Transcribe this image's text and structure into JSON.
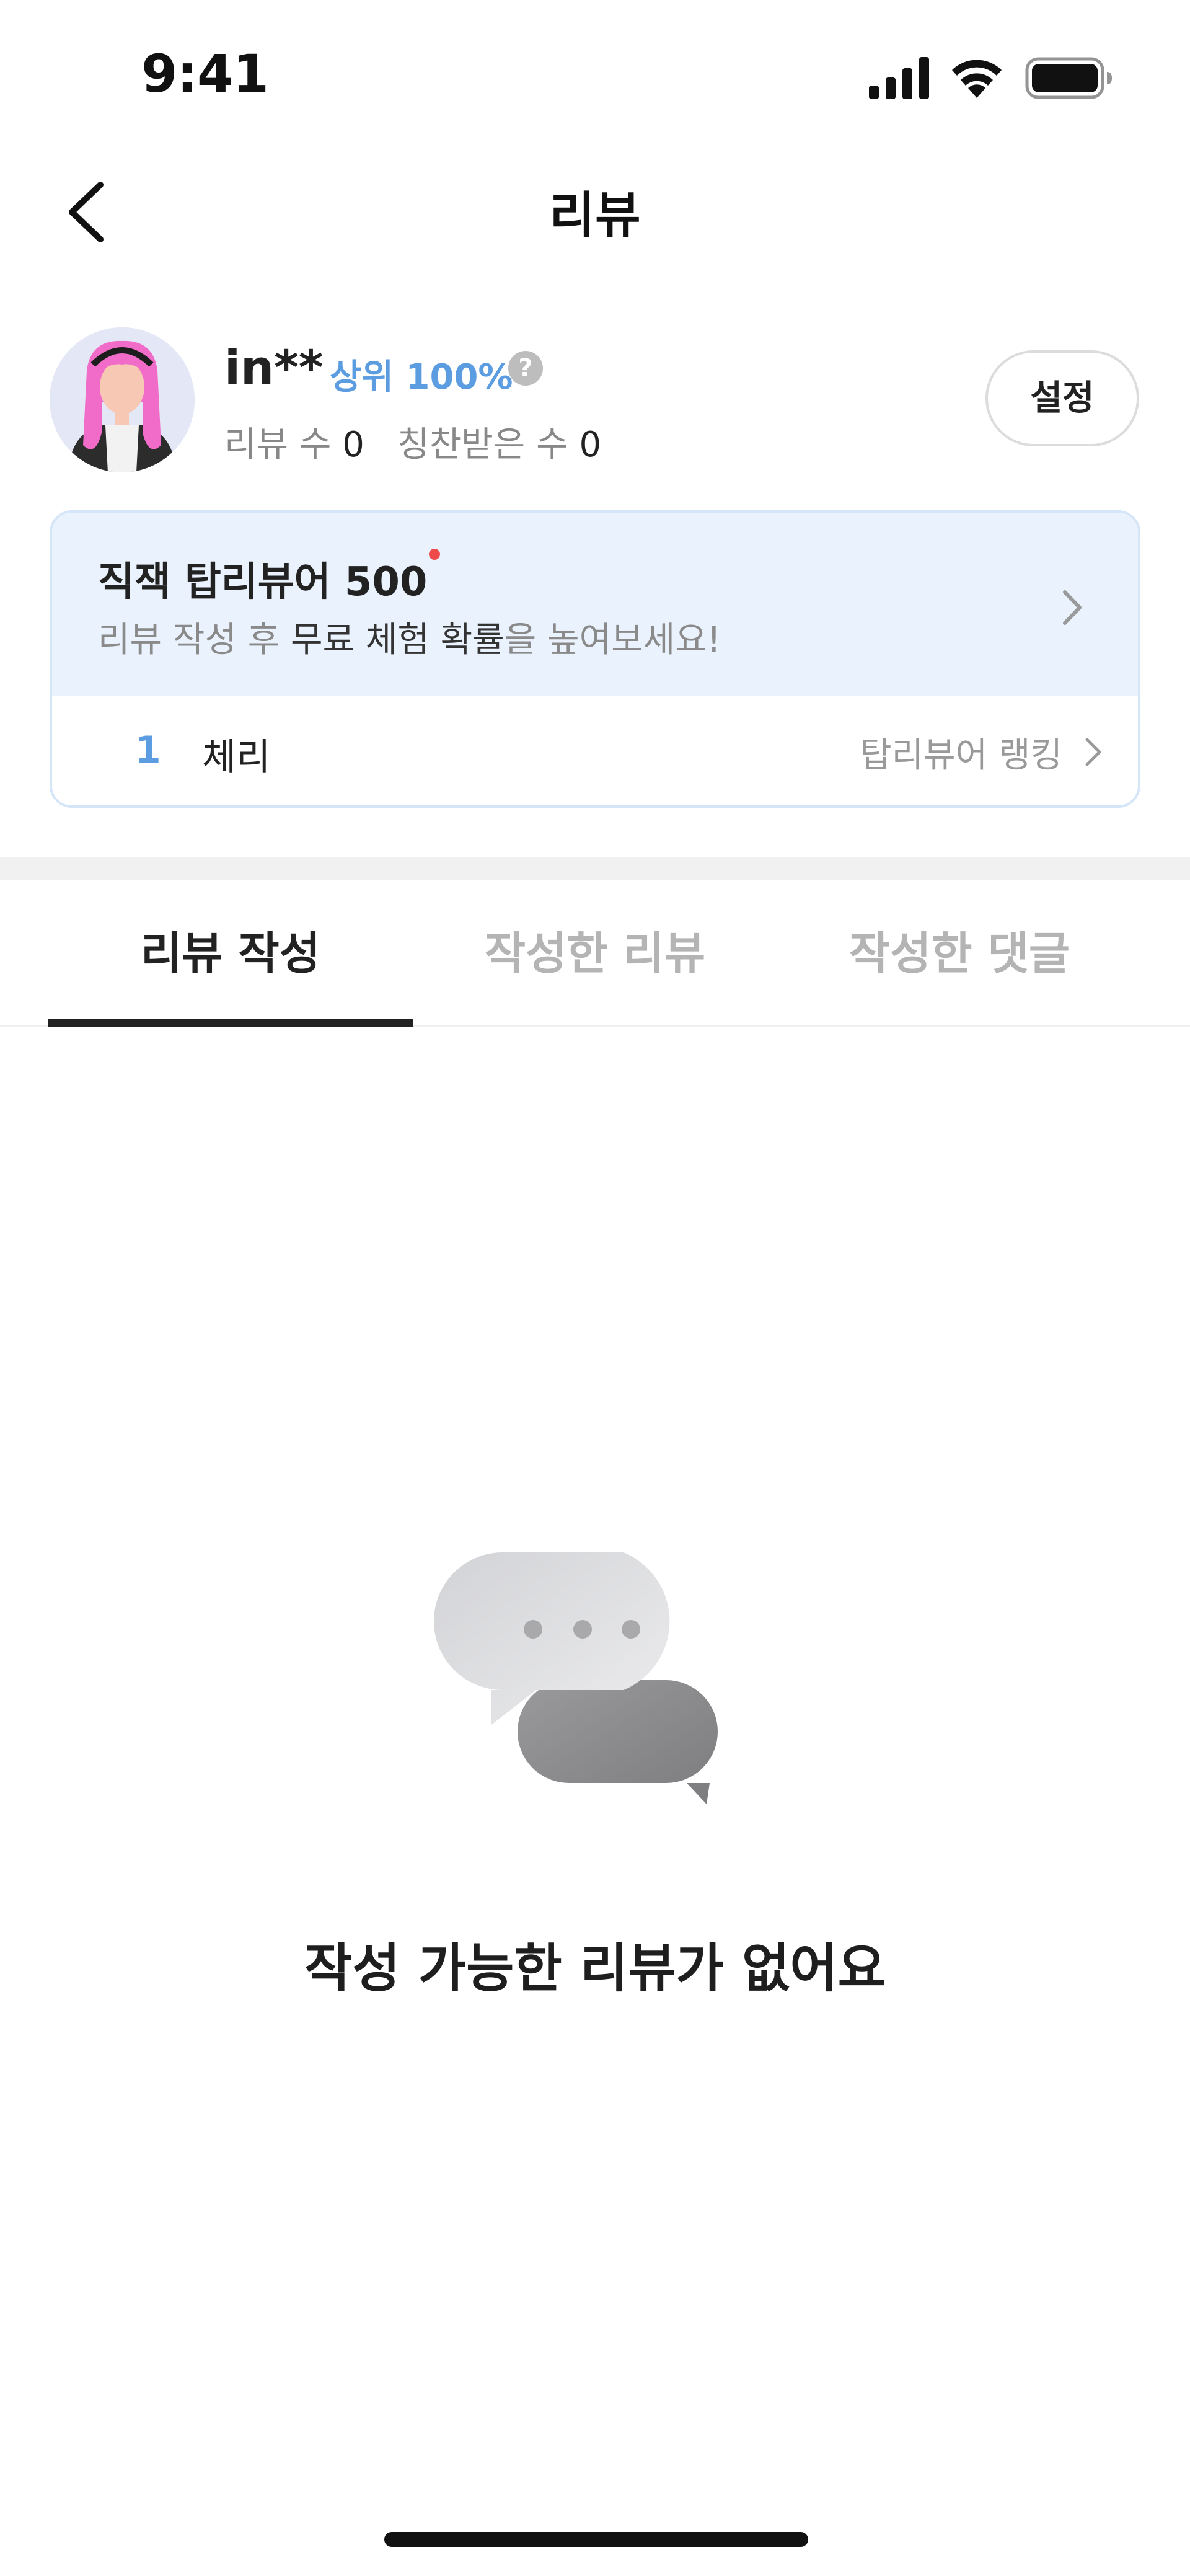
{
  "status_bar": {
    "time": "9:41",
    "icons": [
      "signal-icon",
      "wifi-icon",
      "battery-icon"
    ]
  },
  "nav": {
    "title": "리뷰",
    "back_icon": "chevron-left-icon"
  },
  "profile": {
    "nickname": "in**",
    "rank_badge": "상위 100%",
    "help_symbol": "?",
    "review_count_label": "리뷰 수",
    "review_count": "0",
    "praise_count_label": "칭찬받은 수",
    "praise_count": "0",
    "settings_label": "설정"
  },
  "top_reviewer_card": {
    "title": "직잭 탑리뷰어 500",
    "desc_prefix": "리뷰 작성 후 ",
    "desc_emphasis": "무료 체험 확률",
    "desc_suffix": "을 높여보세요!",
    "rank_number": "1",
    "rank_item_name": "체리",
    "ranking_link_label": "탑리뷰어 랭킹"
  },
  "tabs": [
    {
      "label": "리뷰 작성",
      "active": true
    },
    {
      "label": "작성한 리뷰",
      "active": false
    },
    {
      "label": "작성한 댓글",
      "active": false
    }
  ],
  "empty_state": {
    "icon": "chat-bubbles-icon",
    "message": "작성 가능한 리뷰가 없어요"
  },
  "colors": {
    "accent_blue": "#5b9de0",
    "card_background": "#eaf2fd",
    "card_border": "#d5e6f8",
    "notification_dot": "#ef4a4a",
    "text_primary": "#222222",
    "text_secondary": "#8a8a8a",
    "tab_inactive": "#b4b4b4"
  }
}
